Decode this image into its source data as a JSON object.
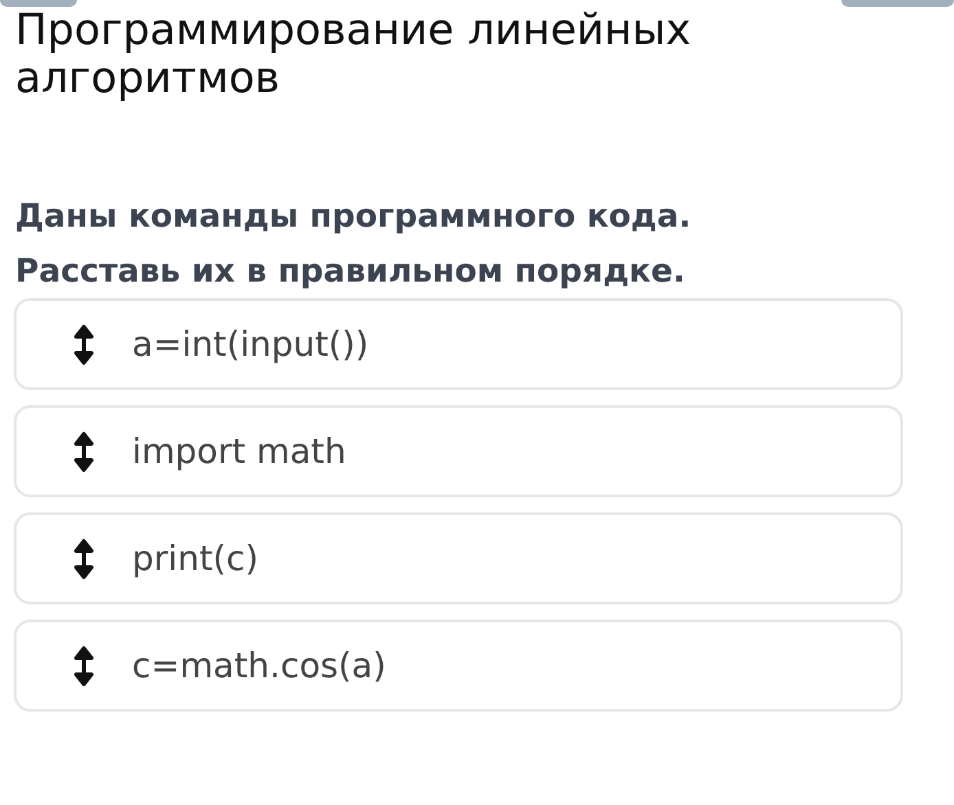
{
  "title": "Программирование линейных алгоритмов",
  "question": "Даны команды программного кода. Расставь их в правильном порядке.",
  "items": [
    {
      "text": "a=int(input())"
    },
    {
      "text": "import math"
    },
    {
      "text": "print(c)"
    },
    {
      "text": "c=math.cos(a)"
    }
  ]
}
